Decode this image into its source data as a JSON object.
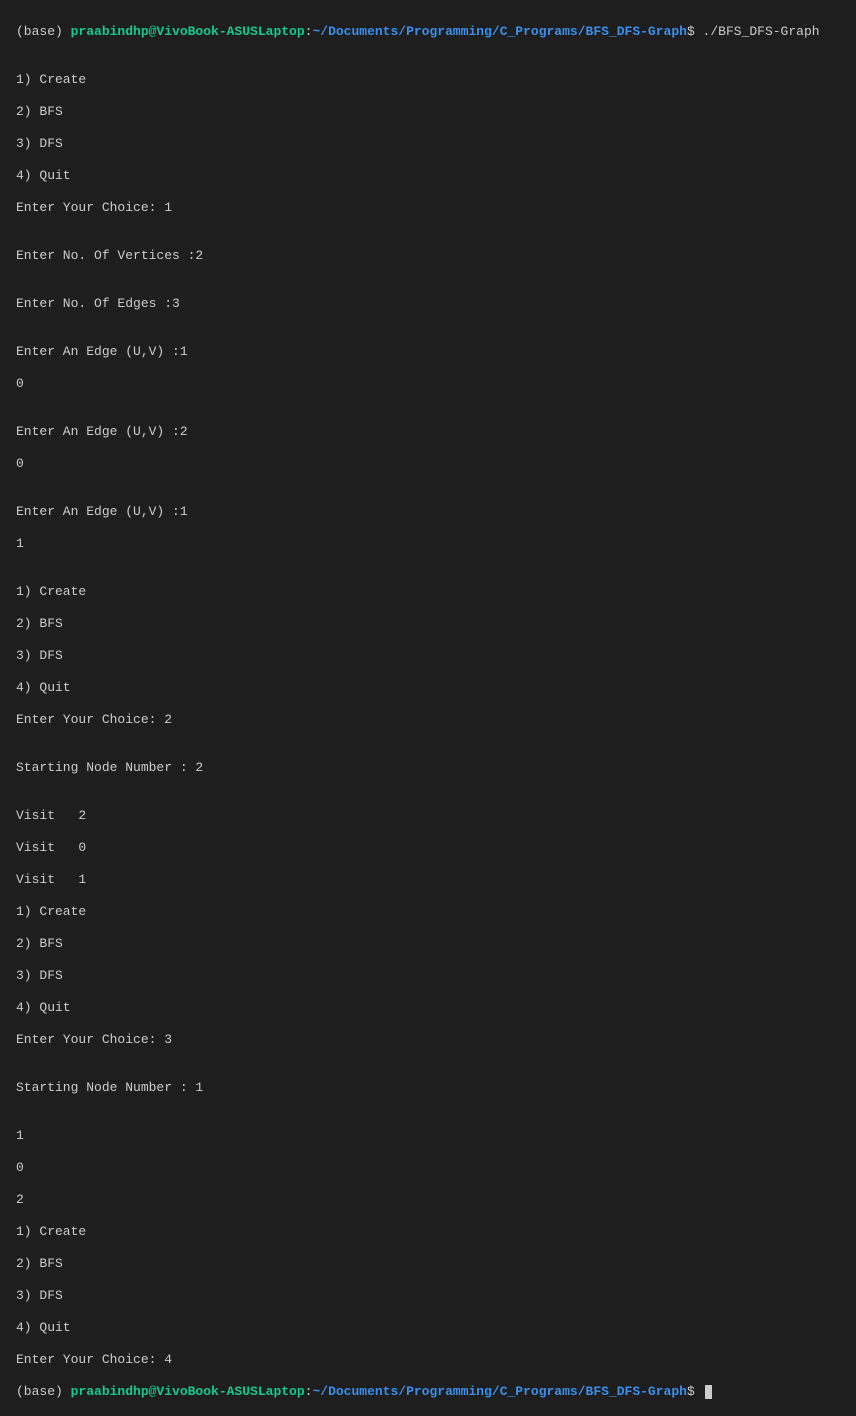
{
  "prompt1": {
    "env": "(base) ",
    "userHost": "praabindhp@VivoBook-ASUSLaptop",
    "colon": ":",
    "path": "~/Documents/Programming/C_Programs/BFS_DFS-Graph",
    "dollar": "$ ",
    "command": "./BFS_DFS-Graph"
  },
  "output": {
    "blank1": "",
    "menu1_1": "1) Create",
    "menu1_2": "2) BFS",
    "menu1_3": "3) DFS",
    "menu1_4": "4) Quit",
    "choice1": "Enter Your Choice: 1",
    "blank2": "",
    "vertices": "Enter No. Of Vertices :2",
    "blank3": "",
    "edges": "Enter No. Of Edges :3",
    "blank4": "",
    "edge1a": "Enter An Edge (U,V) :1",
    "edge1b": "0",
    "blank5": "",
    "edge2a": "Enter An Edge (U,V) :2",
    "edge2b": "0",
    "blank6": "",
    "edge3a": "Enter An Edge (U,V) :1",
    "edge3b": "1",
    "blank7": "",
    "menu2_1": "1) Create",
    "menu2_2": "2) BFS",
    "menu2_3": "3) DFS",
    "menu2_4": "4) Quit",
    "choice2": "Enter Your Choice: 2",
    "blank8": "",
    "startNode1": "Starting Node Number : 2",
    "blank9": "",
    "visit1": "Visit   2",
    "visit2": "Visit   0",
    "visit3": "Visit   1",
    "menu3_1": "1) Create",
    "menu3_2": "2) BFS",
    "menu3_3": "3) DFS",
    "menu3_4": "4) Quit",
    "choice3": "Enter Your Choice: 3",
    "blank10": "",
    "startNode2": "Starting Node Number : 1",
    "blank11": "",
    "dfs1": "1",
    "dfs2": "0",
    "dfs3": "2",
    "menu4_1": "1) Create",
    "menu4_2": "2) BFS",
    "menu4_3": "3) DFS",
    "menu4_4": "4) Quit",
    "choice4": "Enter Your Choice: 4"
  },
  "prompt2": {
    "env": "(base) ",
    "userHost": "praabindhp@VivoBook-ASUSLaptop",
    "colon": ":",
    "path": "~/Documents/Programming/C_Programs/BFS_DFS-Graph",
    "dollar": "$ "
  }
}
